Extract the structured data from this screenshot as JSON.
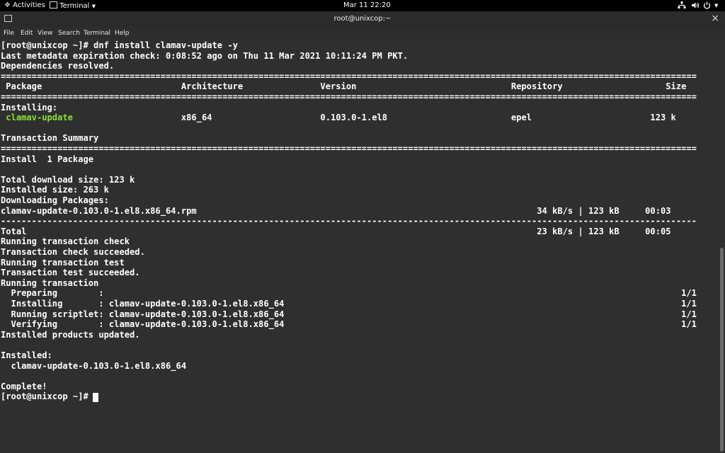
{
  "topbar": {
    "activities": "Activities",
    "terminal_menu": "Terminal",
    "clock": "Mar 11  22:20",
    "network_icon": "network-icon",
    "volume_icon": "volume-icon",
    "power_icon": "power-icon",
    "dropdown_icon": "chevron-down-icon"
  },
  "window": {
    "title": "root@unixcop:~",
    "close_label": "×"
  },
  "menu": [
    "File",
    "Edit",
    "View",
    "Search",
    "Terminal",
    "Help"
  ],
  "terminal": {
    "lines": [
      "[root@unixcop ~]# dnf install clamav-update -y",
      "Last metadata expiration check: 0:08:52 ago on Thu 11 Mar 2021 10:11:24 PM PKT.",
      "Dependencies resolved.",
      "=======================================================================================================================================",
      " Package                           Architecture               Version                              Repository                    Size",
      "=======================================================================================================================================",
      "Installing:",
      "",
      "",
      "Transaction Summary",
      "=======================================================================================================================================",
      "Install  1 Package",
      "",
      "Total download size: 123 k",
      "Installed size: 263 k",
      "Downloading Packages:",
      "clamav-update-0.103.0-1.el8.x86_64.rpm                                                                  34 kB/s | 123 kB     00:03",
      "---------------------------------------------------------------------------------------------------------------------------------------",
      "Total                                                                                                   23 kB/s | 123 kB     00:05",
      "Running transaction check",
      "Transaction check succeeded.",
      "Running transaction test",
      "Transaction test succeeded.",
      "Running transaction",
      "  Preparing        :                                                                                                                1/1",
      "  Installing       : clamav-update-0.103.0-1.el8.x86_64                                                                             1/1",
      "  Running scriptlet: clamav-update-0.103.0-1.el8.x86_64                                                                             1/1",
      "  Verifying        : clamav-update-0.103.0-1.el8.x86_64                                                                             1/1",
      "Installed products updated.",
      "",
      "Installed:",
      "  clamav-update-0.103.0-1.el8.x86_64",
      "",
      "Complete!",
      "[root@unixcop ~]# "
    ],
    "pkg_name": " clamav-update",
    "pkg_rest": "                     x86_64                     0.103.0-1.el8                        epel                       123 k",
    "pkg_color": "#8ae234"
  }
}
